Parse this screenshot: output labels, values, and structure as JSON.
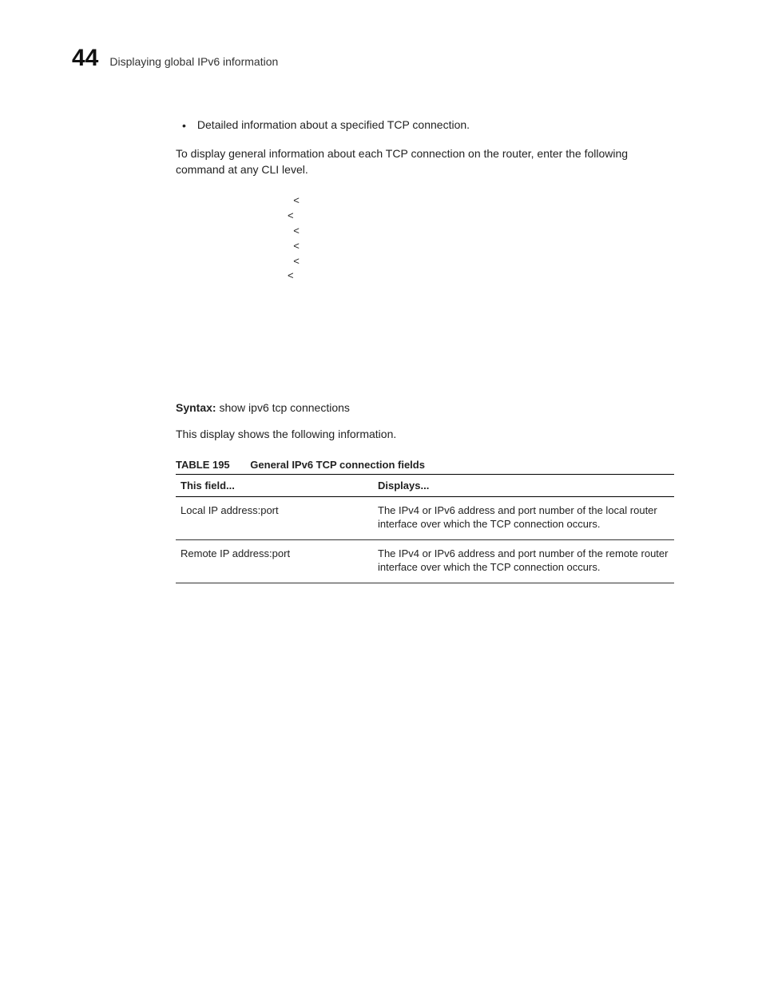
{
  "header": {
    "page_number": "44",
    "title": "Displaying global IPv6 information"
  },
  "bullet": {
    "text": "Detailed information about a specified TCP connection."
  },
  "intro_para": "To display general information about each TCP connection on the router, enter the following command at any CLI level.",
  "code_block": "  <\n<\n  <\n  <\n  <\n<",
  "syntax": {
    "label": "Syntax:",
    "value": "show ipv6 tcp connections"
  },
  "follow_para": "This display shows the following information.",
  "table": {
    "number": "TABLE 195",
    "title": "General IPv6 TCP connection fields",
    "headers": {
      "c1": "This field...",
      "c2": "Displays..."
    },
    "rows": [
      {
        "field": "Local IP address:port",
        "desc": "The IPv4 or IPv6 address and port number of the local router interface over which the TCP connection occurs."
      },
      {
        "field": "Remote IP address:port",
        "desc": "The IPv4 or IPv6 address and port number of the remote router interface over which the TCP connection occurs."
      }
    ]
  }
}
